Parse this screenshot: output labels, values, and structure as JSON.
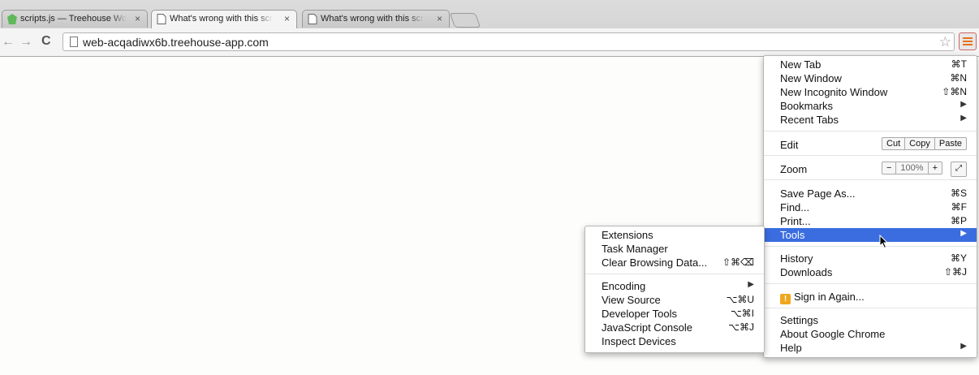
{
  "tabs": [
    {
      "title": "scripts.js — Treehouse Wo",
      "icon": "treehouse-icon"
    },
    {
      "title": "What's wrong with this scr",
      "icon": "page-icon"
    },
    {
      "title": "What's wrong with this scr",
      "icon": "page-icon"
    }
  ],
  "tab_close": "×",
  "toolbar": {
    "back": "←",
    "forward": "→",
    "reload": "C",
    "url": "web-acqadiwx6b.treehouse-app.com",
    "star": "☆"
  },
  "main_menu": {
    "new_tab": {
      "label": "New Tab",
      "shortcut": "⌘T"
    },
    "new_window": {
      "label": "New Window",
      "shortcut": "⌘N"
    },
    "new_incognito": {
      "label": "New Incognito Window",
      "shortcut": "⇧⌘N"
    },
    "bookmarks": {
      "label": "Bookmarks",
      "arrow": "▶"
    },
    "recent_tabs": {
      "label": "Recent Tabs",
      "arrow": "▶"
    },
    "edit": {
      "label": "Edit",
      "cut": "Cut",
      "copy": "Copy",
      "paste": "Paste"
    },
    "zoom": {
      "label": "Zoom",
      "minus": "−",
      "level": "100%",
      "plus": "+",
      "fullscreen": "⤢"
    },
    "save_page": {
      "label": "Save Page As...",
      "shortcut": "⌘S"
    },
    "find": {
      "label": "Find...",
      "shortcut": "⌘F"
    },
    "print": {
      "label": "Print...",
      "shortcut": "⌘P"
    },
    "tools": {
      "label": "Tools",
      "arrow": "▶"
    },
    "history": {
      "label": "History",
      "shortcut": "⌘Y"
    },
    "downloads": {
      "label": "Downloads",
      "shortcut": "⇧⌘J"
    },
    "sign_in": {
      "label": "Sign in Again...",
      "badge": "!"
    },
    "settings": {
      "label": "Settings"
    },
    "about": {
      "label": "About Google Chrome"
    },
    "help": {
      "label": "Help",
      "arrow": "▶"
    }
  },
  "tools_menu": {
    "extensions": {
      "label": "Extensions"
    },
    "task_manager": {
      "label": "Task Manager"
    },
    "clear_browsing": {
      "label": "Clear Browsing Data...",
      "shortcut": "⇧⌘⌫"
    },
    "encoding": {
      "label": "Encoding",
      "arrow": "▶"
    },
    "view_source": {
      "label": "View Source",
      "shortcut": "⌥⌘U"
    },
    "developer_tools": {
      "label": "Developer Tools",
      "shortcut": "⌥⌘I"
    },
    "js_console": {
      "label": "JavaScript Console",
      "shortcut": "⌥⌘J"
    },
    "inspect_devices": {
      "label": "Inspect Devices"
    }
  },
  "colors": {
    "highlight": "#3b6de0",
    "menu_accent": "#e8701a"
  }
}
